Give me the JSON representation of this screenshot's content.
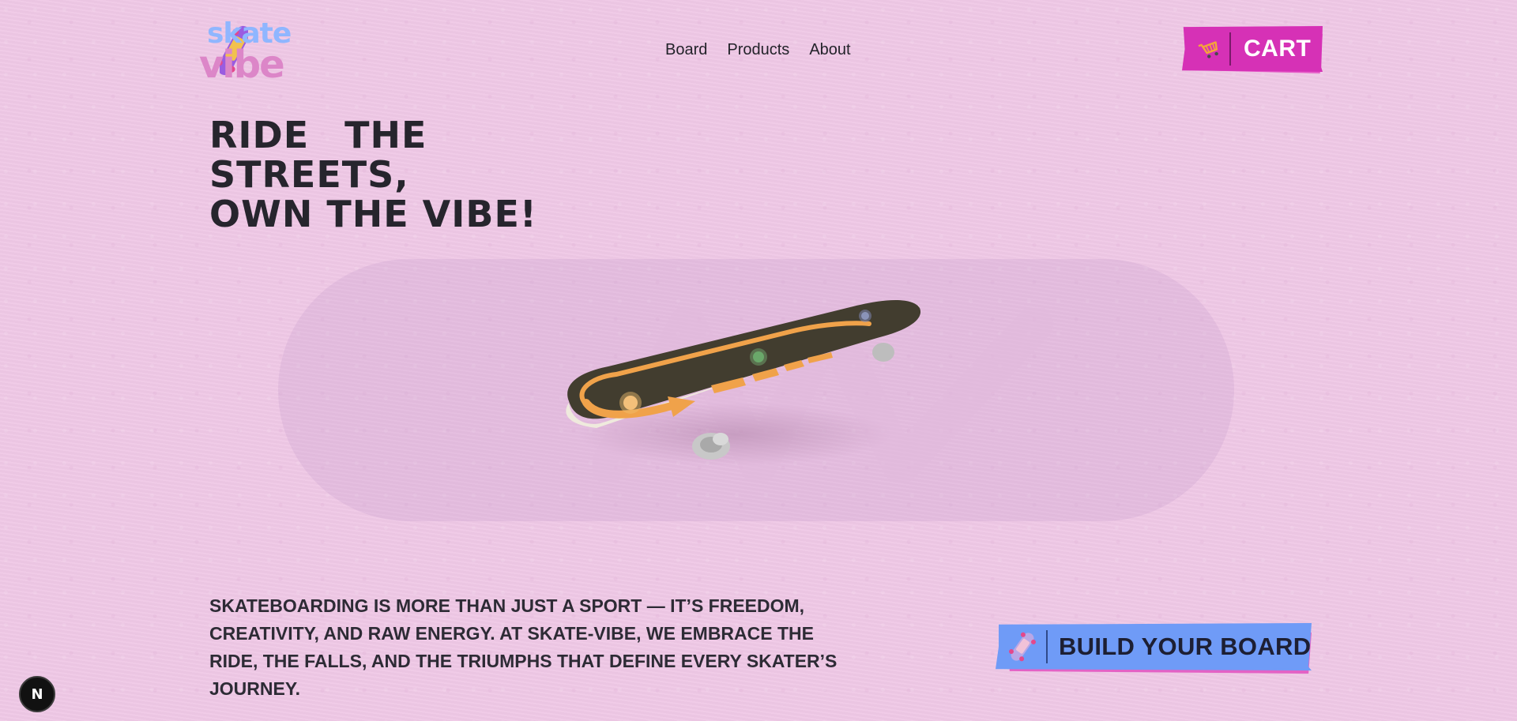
{
  "logo": {
    "line1": "skate",
    "line2": "vibe",
    "icon": "skateboard-logo-icon"
  },
  "nav": {
    "items": [
      {
        "label": "Board"
      },
      {
        "label": "Products"
      },
      {
        "label": "About"
      }
    ]
  },
  "cart": {
    "label": "CART",
    "icon": "shopping-cart-icon",
    "color": "#d631b6"
  },
  "hero": {
    "line1": "RIDE THE STREETS,",
    "line2": "OWN THE VIBE!"
  },
  "product": {
    "image": "skateboard-3d",
    "deck_color": "#3f3a2c",
    "graphic_color": "#f0a24a"
  },
  "tagline": "SKATEBOARDING IS MORE THAN JUST A SPORT — IT’S FREEDOM, CREATIVITY, AND RAW ENERGY. AT SKATE-VIBE, WE EMBRACE THE RIDE, THE FALLS, AND THE TRIUMPHS THAT DEFINE EVERY SKATER’S JOURNEY.",
  "cta": {
    "label": "BUILD YOUR BOARD",
    "icon": "skateboard-icon",
    "color": "#6f9bf7"
  },
  "dev_indicator": {
    "label": "N",
    "icon": "nextjs-icon"
  },
  "colors": {
    "background": "#efc8e6",
    "accent_pink": "#d631b6",
    "accent_blue": "#6f9bf7",
    "text": "#26252d"
  }
}
